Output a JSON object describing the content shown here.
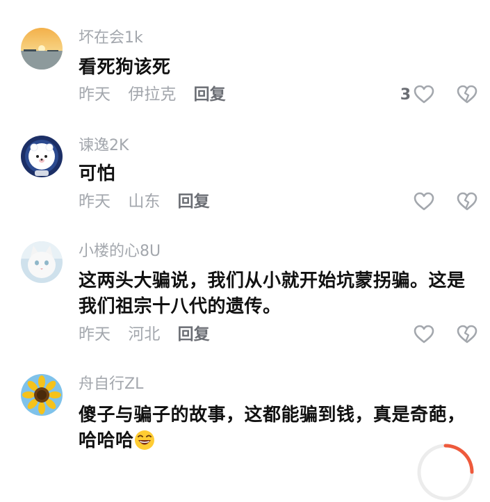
{
  "comments": [
    {
      "username": "坏在会1k",
      "text": "看死狗该死",
      "time": "昨天",
      "location": "伊拉克",
      "reply_label": "回复",
      "like_count": "3",
      "avatar": "sunset-avatar"
    },
    {
      "username": "谏逸2K",
      "text": "可怕",
      "time": "昨天",
      "location": "山东",
      "reply_label": "回复",
      "like_count": "",
      "avatar": "astronaut-bear-avatar"
    },
    {
      "username": "小楼的心8U",
      "text": "这两头大骗说，我们从小就开始坑蒙拐骗。这是我们祖宗十八代的遗传。",
      "time": "昨天",
      "location": "河北",
      "reply_label": "回复",
      "like_count": "",
      "avatar": "white-cat-avatar"
    },
    {
      "username": "舟自行ZL",
      "text": "傻子与骗子的故事，这都能骗到钱，真是奇葩，哈哈哈",
      "avatar": "sunflower-avatar"
    }
  ],
  "colors": {
    "text_primary": "#111111",
    "text_secondary": "#a3a7ad",
    "reply": "#6b6e74",
    "accent": "#ee5a3c"
  },
  "icons": [
    "heart-icon",
    "broken-heart-icon",
    "grinning-emoji-icon",
    "loading-ring-icon"
  ]
}
